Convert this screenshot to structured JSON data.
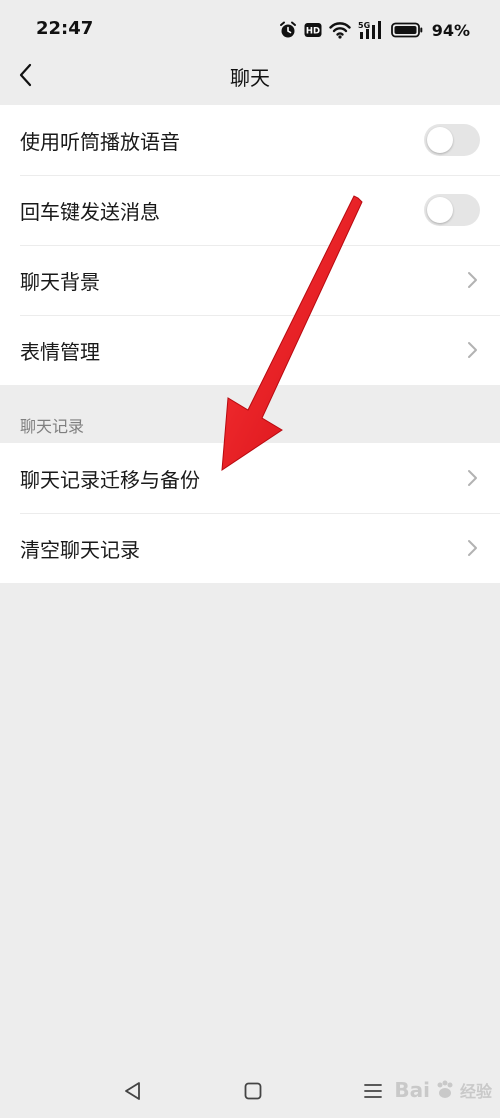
{
  "status_bar": {
    "time": "22:47",
    "battery": "94%",
    "icons": [
      "alarm-icon",
      "hd-icon",
      "wifi-icon",
      "5g-signal-icon",
      "battery-icon"
    ]
  },
  "nav": {
    "title": "聊天",
    "back_icon": "chevron-left-icon"
  },
  "settings": {
    "general": [
      {
        "label": "使用听筒播放语音",
        "control": "toggle",
        "on": false
      },
      {
        "label": "回车键发送消息",
        "control": "toggle",
        "on": false
      },
      {
        "label": "聊天背景",
        "control": "chevron"
      },
      {
        "label": "表情管理",
        "control": "chevron"
      }
    ],
    "history_header": "聊天记录",
    "history": [
      {
        "label": "聊天记录迁移与备份",
        "control": "chevron"
      },
      {
        "label": "清空聊天记录",
        "control": "chevron"
      }
    ]
  },
  "bottom_nav": [
    "back-triangle-icon",
    "home-square-icon",
    "menu-lines-icon"
  ],
  "watermark": {
    "brand": "Bai",
    "sub": "经验"
  },
  "colors": {
    "background": "#ededed",
    "row_background": "#ffffff",
    "annotation_arrow": "#e8131c",
    "toggle_off": "#e5e5e5"
  }
}
